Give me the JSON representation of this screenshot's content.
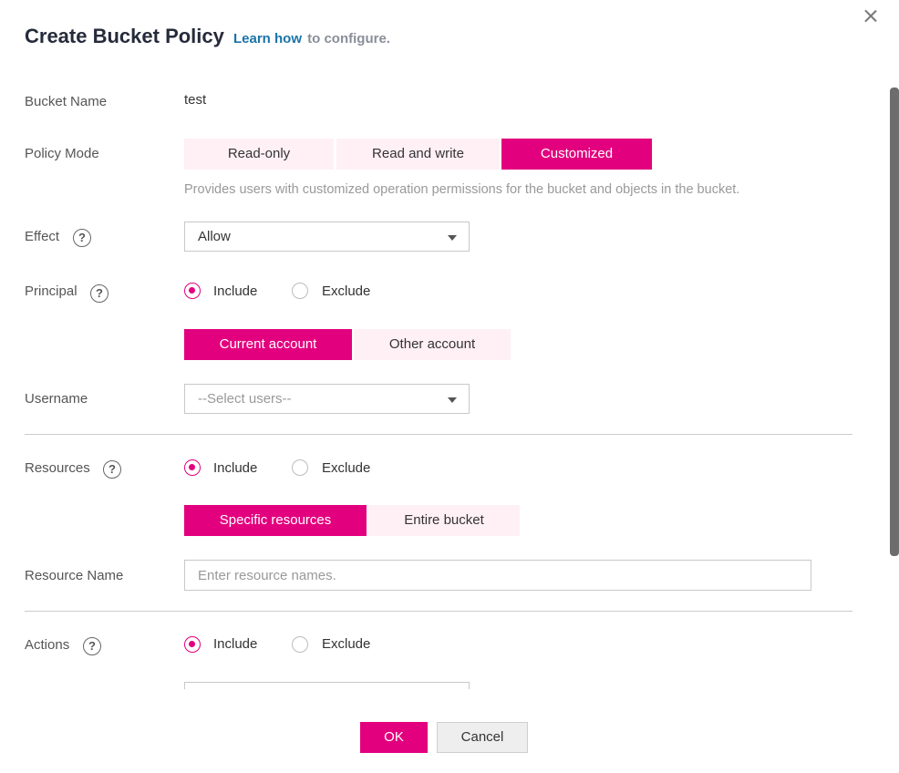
{
  "dialog": {
    "title": "Create Bucket Policy",
    "learn_link": "Learn how",
    "learn_suffix": "to configure.",
    "close_icon": "close-icon"
  },
  "bucket_name": {
    "label": "Bucket Name",
    "value": "test"
  },
  "policy_mode": {
    "label": "Policy Mode",
    "options": [
      "Read-only",
      "Read and write",
      "Customized"
    ],
    "selected": "Customized",
    "hint": "Provides users with customized operation permissions for the bucket and objects in the bucket."
  },
  "effect": {
    "label": "Effect",
    "help": "?",
    "value": "Allow"
  },
  "principal": {
    "label": "Principal",
    "help": "?",
    "include": "Include",
    "exclude": "Exclude",
    "selected": "Include",
    "tabs": [
      "Current account",
      "Other account"
    ],
    "selected_tab": "Current account"
  },
  "username": {
    "label": "Username",
    "placeholder": "--Select users--"
  },
  "resources": {
    "label": "Resources",
    "help": "?",
    "include": "Include",
    "exclude": "Exclude",
    "selected": "Include",
    "tabs": [
      "Specific resources",
      "Entire bucket"
    ],
    "selected_tab": "Specific resources"
  },
  "resource_name": {
    "label": "Resource Name",
    "placeholder": "Enter resource names."
  },
  "actions": {
    "label": "Actions",
    "help": "?",
    "include": "Include",
    "exclude": "Exclude",
    "selected": "Include"
  },
  "footer": {
    "ok": "OK",
    "cancel": "Cancel"
  },
  "colors": {
    "accent": "#e3007e",
    "accent_light": "#fff0f6",
    "link": "#1a73a8"
  }
}
